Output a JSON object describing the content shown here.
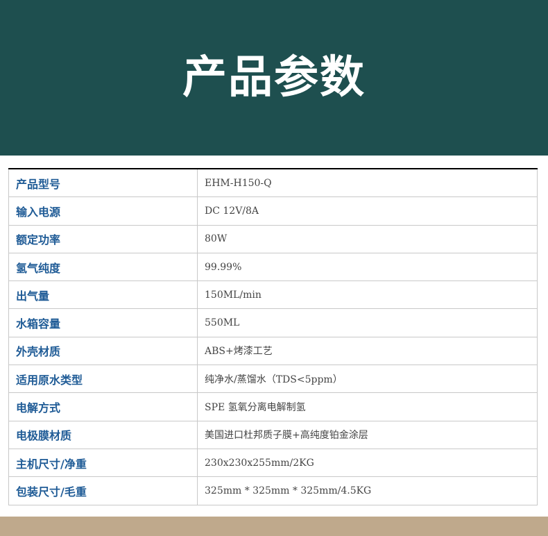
{
  "header": {
    "title": "产品参数"
  },
  "specs": [
    {
      "label": "产品型号",
      "value": "EHM-H150-Q"
    },
    {
      "label": "输入电源",
      "value": "DC 12V/8A"
    },
    {
      "label": "额定功率",
      "value": "80W"
    },
    {
      "label": "氢气纯度",
      "value": "99.99%"
    },
    {
      "label": "出气量",
      "value": "150ML/min"
    },
    {
      "label": "水箱容量",
      "value": "550ML"
    },
    {
      "label": "外壳材质",
      "value": "ABS+烤漆工艺"
    },
    {
      "label": "适用原水类型",
      "value": "纯净水/蒸馏水（TDS<5ppm）"
    },
    {
      "label": "电解方式",
      "value": "SPE 氢氧分离电解制氢"
    },
    {
      "label": "电极膜材质",
      "value": "美国进口杜邦质子膜+高纯度铂金涂层"
    },
    {
      "label": "主机尺寸/净重",
      "value": "230x230x255mm/2KG"
    },
    {
      "label": "包装尺寸/毛重",
      "value": "325mm * 325mm * 325mm/4.5KG"
    }
  ],
  "colors": {
    "header_bg": "#1e4f4f",
    "label_text": "#1f5b96",
    "page_bg": "#bfa98c"
  }
}
